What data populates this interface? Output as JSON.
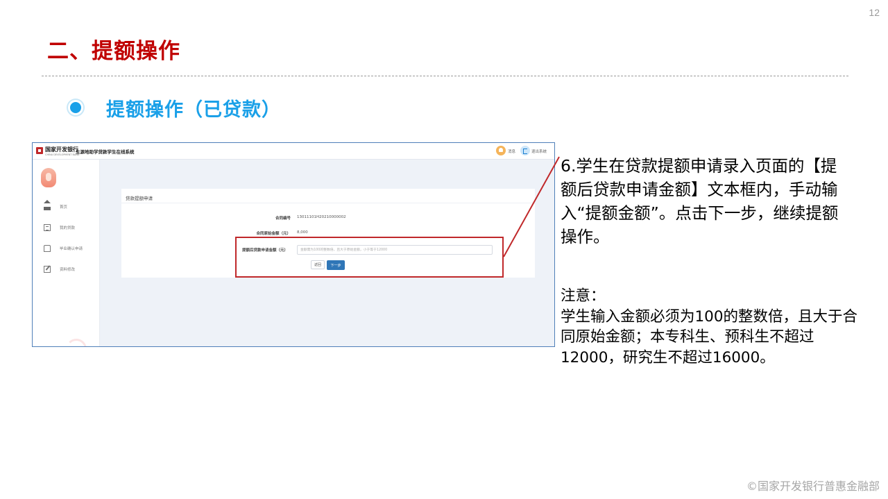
{
  "page_number": "12",
  "slide_title": "二、提额操作",
  "section_title": "提额操作（已贷款）",
  "screenshot": {
    "brand_name": "国家开发银行",
    "brand_sub": "CHINA DEVELOPMENT BANK",
    "system_name": "生源地助学贷款学生在线系统",
    "header": {
      "message_label": "消息",
      "logout_label": "退出系统"
    },
    "sidebar": {
      "items": [
        {
          "label": "首页",
          "icon": "home-icon"
        },
        {
          "label": "我的贷款",
          "icon": "document-icon"
        },
        {
          "label": "毕业确认申请",
          "icon": "graduation-icon"
        },
        {
          "label": "资料修改",
          "icon": "edit-icon"
        }
      ]
    },
    "form": {
      "title": "贷款提额申请",
      "contract_number_label": "合同编号",
      "contract_number_value": "13011101H20210000002",
      "original_amount_label": "合同原始金额（元）",
      "original_amount_value": "8,000",
      "increase_amount_label": "提额后贷款申请金额（元）",
      "increase_amount_value": "",
      "increase_amount_placeholder": "金额需为100的整数倍，且大于原始金额，小于等于12000",
      "back_label": "返回",
      "next_label": "下一步"
    }
  },
  "instruction": "6.学生在贷款提额申请录入页面的【提额后贷款申请金额】文本框内，手动输入“提额金额”。点击下一步，继续提额操作。",
  "note": {
    "heading": "注意：",
    "body": "学生输入金额必须为100的整数倍，且大于合同原始金额；本专科生、预科生不超过12000，研究生不超过16000。"
  },
  "footer": "©国家开发银行普惠金融部",
  "colors": {
    "title_red": "#c00000",
    "accent_blue": "#1aa0e8",
    "highlight_red": "#c0282a",
    "button_blue": "#2f76b7"
  }
}
